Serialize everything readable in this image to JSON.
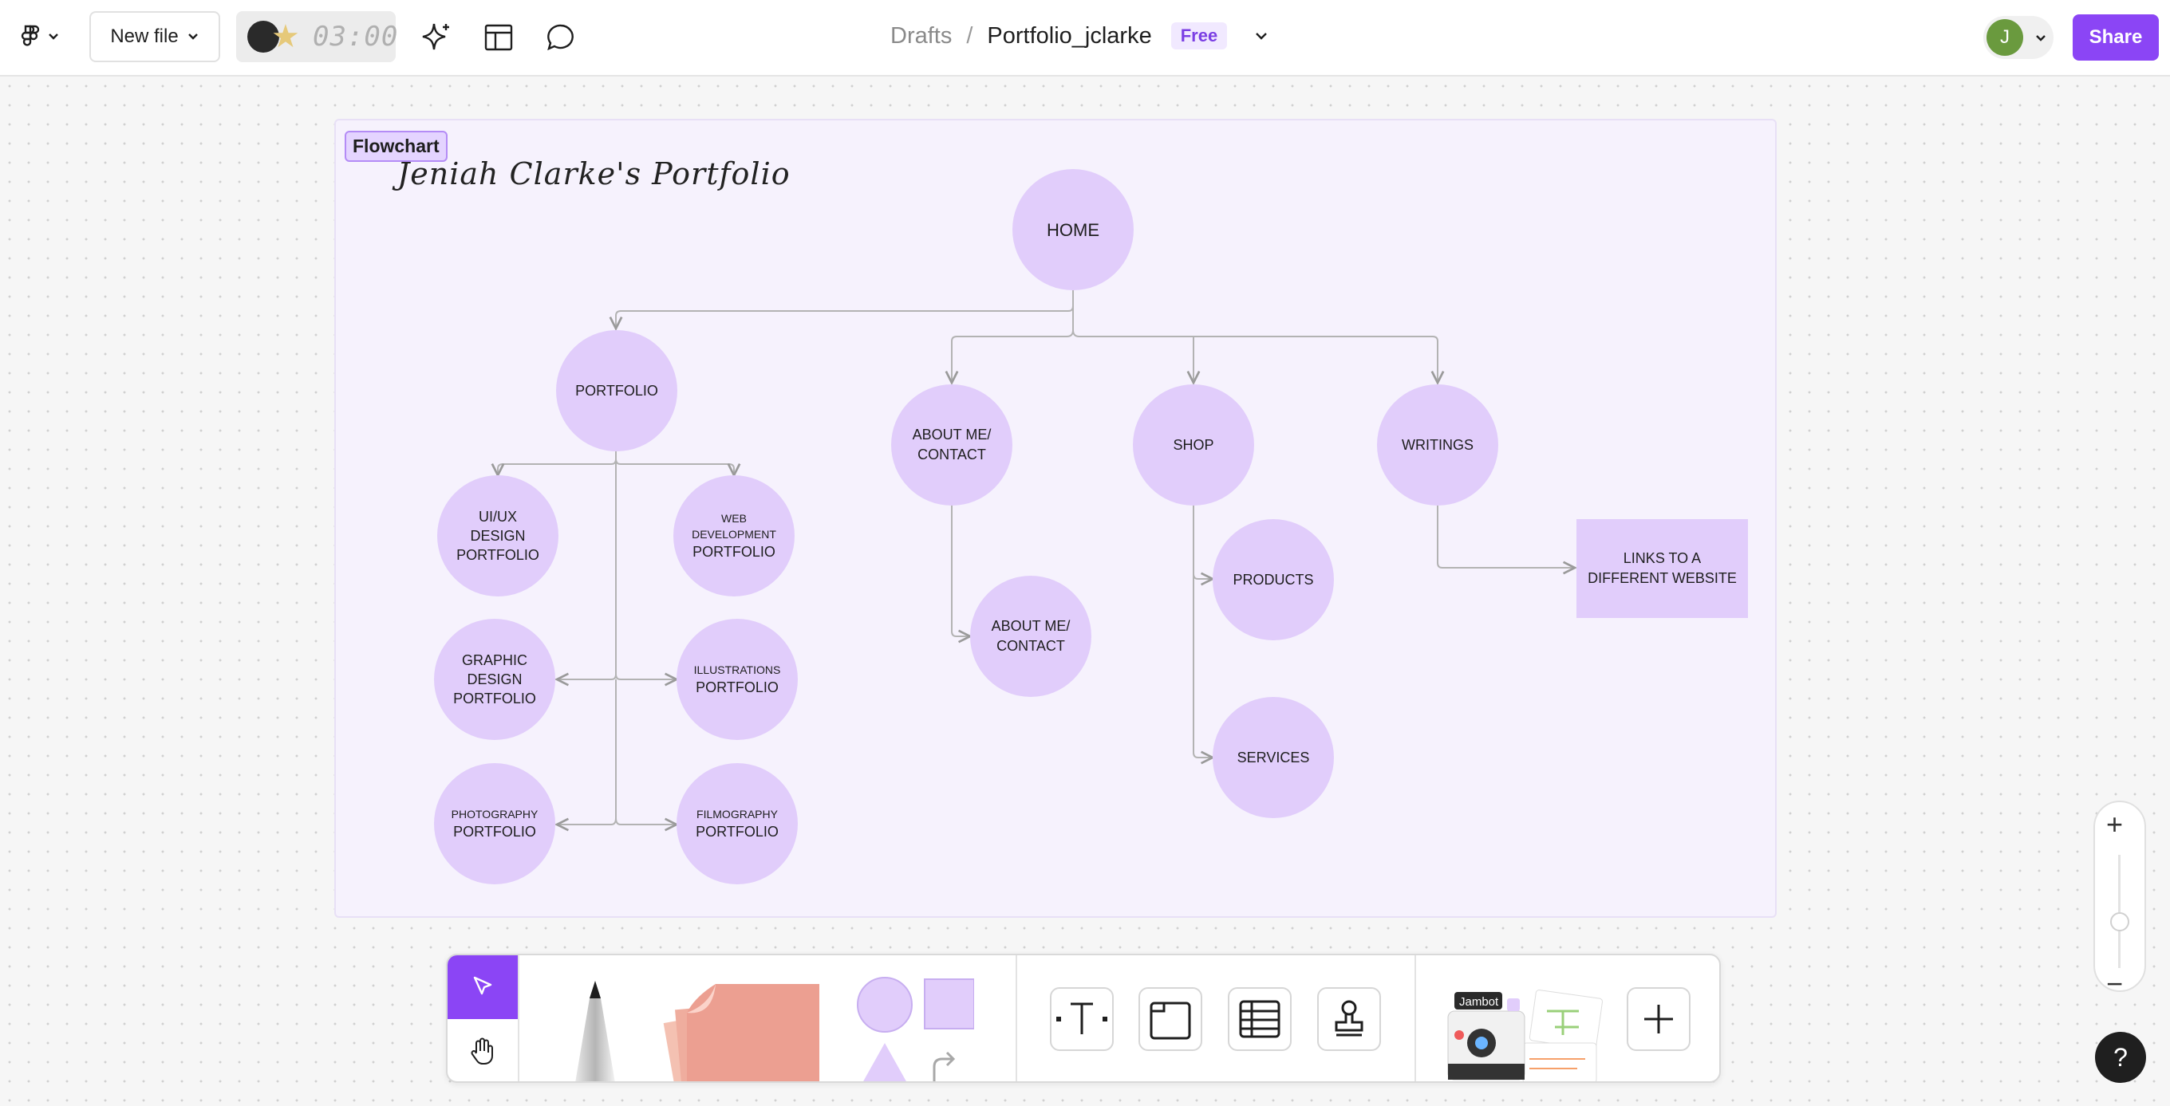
{
  "header": {
    "new_file_label": "New file",
    "timer": "03:00",
    "breadcrumb_root": "Drafts",
    "breadcrumb_sep": "/",
    "file_name": "Portfolio_jclarke",
    "plan_badge": "Free",
    "avatar_initial": "J",
    "share_label": "Share"
  },
  "section": {
    "label": "Flowchart",
    "title": "Jeniah Clarke's Portfolio"
  },
  "nodes": {
    "home": "HOME",
    "portfolio": "PORTFOLIO",
    "about": "ABOUT ME/ CONTACT",
    "shop": "SHOP",
    "writings": "WRITINGS",
    "uiux_line1": "UI/UX",
    "uiux_line2": "DESIGN",
    "uiux_line3": "PORTFOLIO",
    "webdev_small1": "WEB",
    "webdev_small2": "DEVELOPMENT",
    "webdev_big": "PORTFOLIO",
    "graphic_line1": "GRAPHIC",
    "graphic_line2": "DESIGN",
    "graphic_line3": "PORTFOLIO",
    "illus_small": "ILLUSTRATIONS",
    "illus_big": "PORTFOLIO",
    "photo_small": "PHOTOGRAPHY",
    "photo_big": "PORTFOLIO",
    "film_small": "FILMOGRAPHY",
    "film_big": "PORTFOLIO",
    "about_child": "ABOUT ME/ CONTACT",
    "products": "PRODUCTS",
    "services": "SERVICES",
    "links": "LINKS TO A DIFFERENT WEBSITE"
  },
  "colors": {
    "accent": "#8b45f5",
    "node_fill": "#e1cdfb",
    "section_fill": "#f6f2fd",
    "connector": "#b3b3b3"
  },
  "icons": {
    "menu": "figma-logo-icon",
    "ai": "sparkle-icon",
    "layout": "layout-icon",
    "comment": "comment-icon",
    "select": "cursor-icon",
    "hand": "hand-icon",
    "pen": "marker-icon",
    "sticky": "sticky-note-icon",
    "shapes": "shapes-icon",
    "text": "text-icon",
    "section": "section-icon",
    "table": "table-icon",
    "stamp": "stamp-icon",
    "more": "plus-icon",
    "zoom_in": "zoom-in-icon",
    "zoom_out": "zoom-out-icon",
    "help": "help-icon"
  },
  "zoom": {
    "plus": "+",
    "minus": "−"
  },
  "help_label": "?",
  "toolbar": {
    "text_tool": "T",
    "jambot_label": "Jambot"
  }
}
